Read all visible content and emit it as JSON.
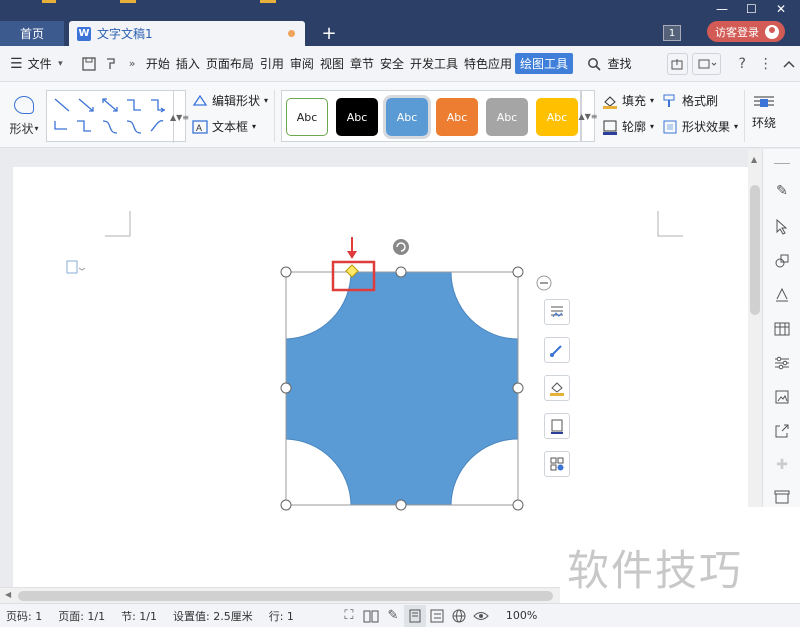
{
  "title_bar": {
    "home_tab": "首页",
    "doc_tab": "文字文稿1",
    "doc_icon_letter": "W",
    "page_count_badge": "1",
    "login_button": "访客登录",
    "colors": {
      "bar": "#2c3f66",
      "login": "#d25b55"
    }
  },
  "menubar": {
    "file": "文件",
    "items": [
      "开始",
      "插入",
      "页面布局",
      "引用",
      "审阅",
      "视图",
      "章节",
      "安全",
      "开发工具",
      "特色应用"
    ],
    "active_item": "绘图工具",
    "search": "查找"
  },
  "ribbon": {
    "shape_label": "形状",
    "edit_shape": "编辑形状",
    "text_box": "文本框",
    "styles": [
      {
        "label": "Abc",
        "bg": "#ffffff",
        "fg": "#222222",
        "border": "#6aa84f"
      },
      {
        "label": "Abc",
        "bg": "#000000",
        "fg": "#ffffff",
        "border": "#000000"
      },
      {
        "label": "Abc",
        "bg": "#5b9bd5",
        "fg": "#ffffff",
        "border": "#5b9bd5"
      },
      {
        "label": "Abc",
        "bg": "#ed7d31",
        "fg": "#ffffff",
        "border": "#ed7d31"
      },
      {
        "label": "Abc",
        "bg": "#a5a5a5",
        "fg": "#ffffff",
        "border": "#a5a5a5"
      },
      {
        "label": "Abc",
        "bg": "#ffc000",
        "fg": "#ffffff",
        "border": "#ffc000"
      }
    ],
    "fill": "填充",
    "outline": "轮廓",
    "format_painter": "格式刷",
    "shape_effects": "形状效果",
    "wrap": "环绕"
  },
  "document": {
    "shape_fill": "#5b9bd5",
    "highlight_color": "#e03c3c"
  },
  "statusbar": {
    "page_num": "页码: 1",
    "pages": "页面: 1/1",
    "section": "节: 1/1",
    "setting": "设置值: 2.5厘米",
    "row": "行: 1",
    "zoom": "100%"
  },
  "watermark": "软件技巧"
}
